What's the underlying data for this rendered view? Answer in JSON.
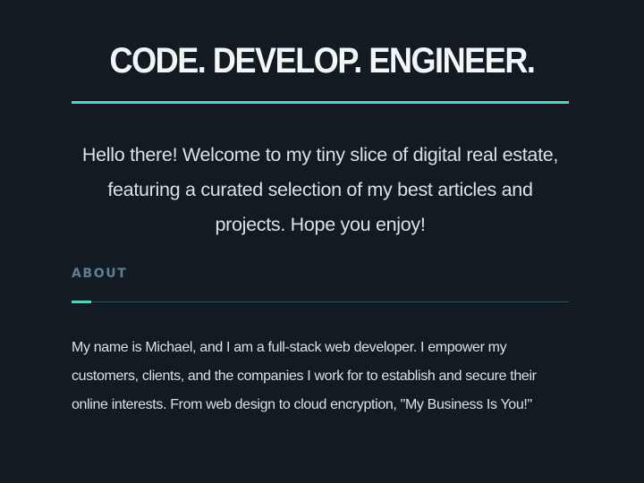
{
  "hero": {
    "title": "CODE. DEVELOP. ENGINEER.",
    "intro": "Hello there! Welcome to my tiny slice of digital real estate, featuring a curated selection of my best articles and projects. Hope you enjoy!"
  },
  "about": {
    "label": "ABOUT",
    "text": "My name is Michael, and I am a full-stack web developer. I empower my customers, clients, and the companies I work for to establish and secure their online interests. From web design to cloud encryption, \"My Business Is You!\""
  },
  "colors": {
    "background": "#111b21",
    "accent": "#48d8bd",
    "label": "#5f8094",
    "divider": "#34505e",
    "text": "#d7e1e7"
  }
}
